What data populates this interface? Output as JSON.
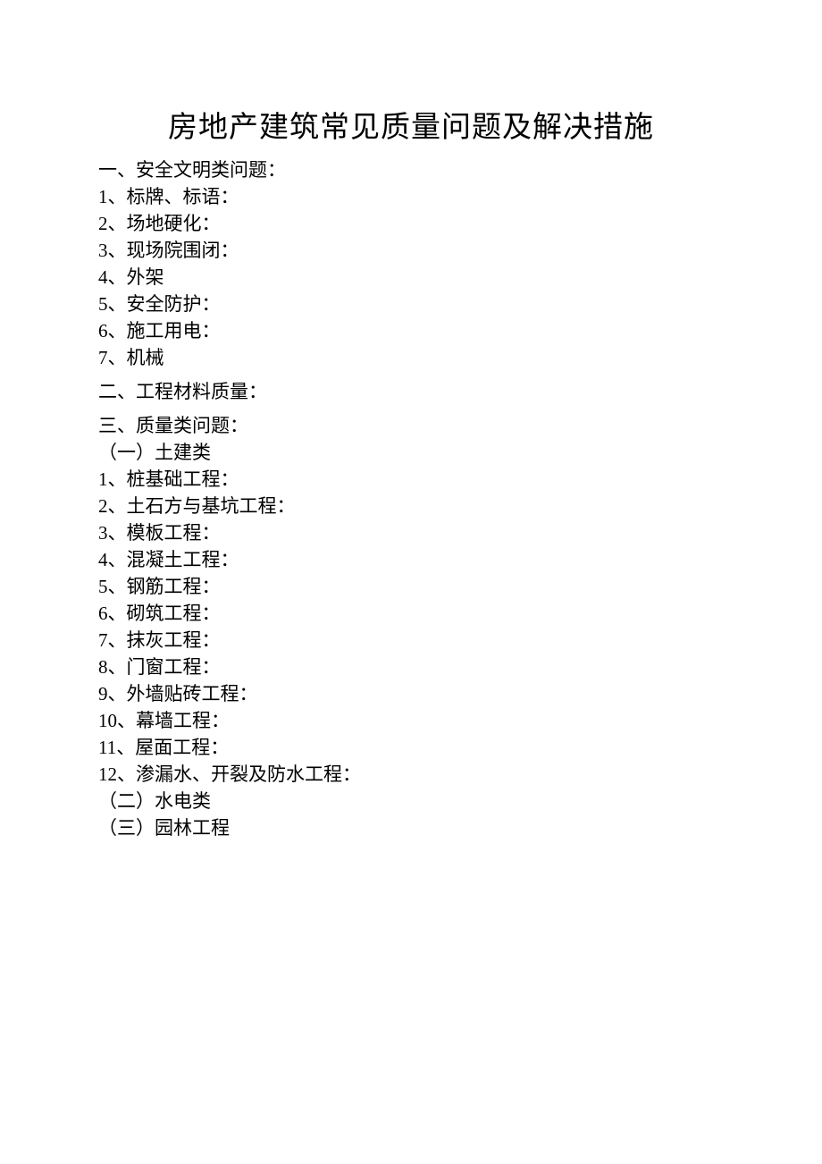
{
  "title": "房地产建筑常见质量问题及解决措施",
  "section1": {
    "header": "一、安全文明类问题：",
    "items": [
      "1、标牌、标语：",
      "2、场地硬化：",
      "3、现场院围闭：",
      "4、外架",
      "5、安全防护：",
      "6、施工用电：",
      "7、机械"
    ]
  },
  "section2": {
    "header": "二、工程材料质量："
  },
  "section3": {
    "header": "三、质量类问题：",
    "sub1": "（一）土建类",
    "items": [
      "1、桩基础工程：",
      "2、土石方与基坑工程：",
      "3、模板工程：",
      "4、混凝土工程：",
      "5、钢筋工程：",
      "6、砌筑工程：",
      "7、抹灰工程：",
      "8、门窗工程：",
      "9、外墙贴砖工程：",
      "10、幕墙工程：",
      "11、屋面工程：",
      "12、渗漏水、开裂及防水工程："
    ],
    "sub2": "（二）水电类",
    "sub3": "（三）园林工程"
  }
}
